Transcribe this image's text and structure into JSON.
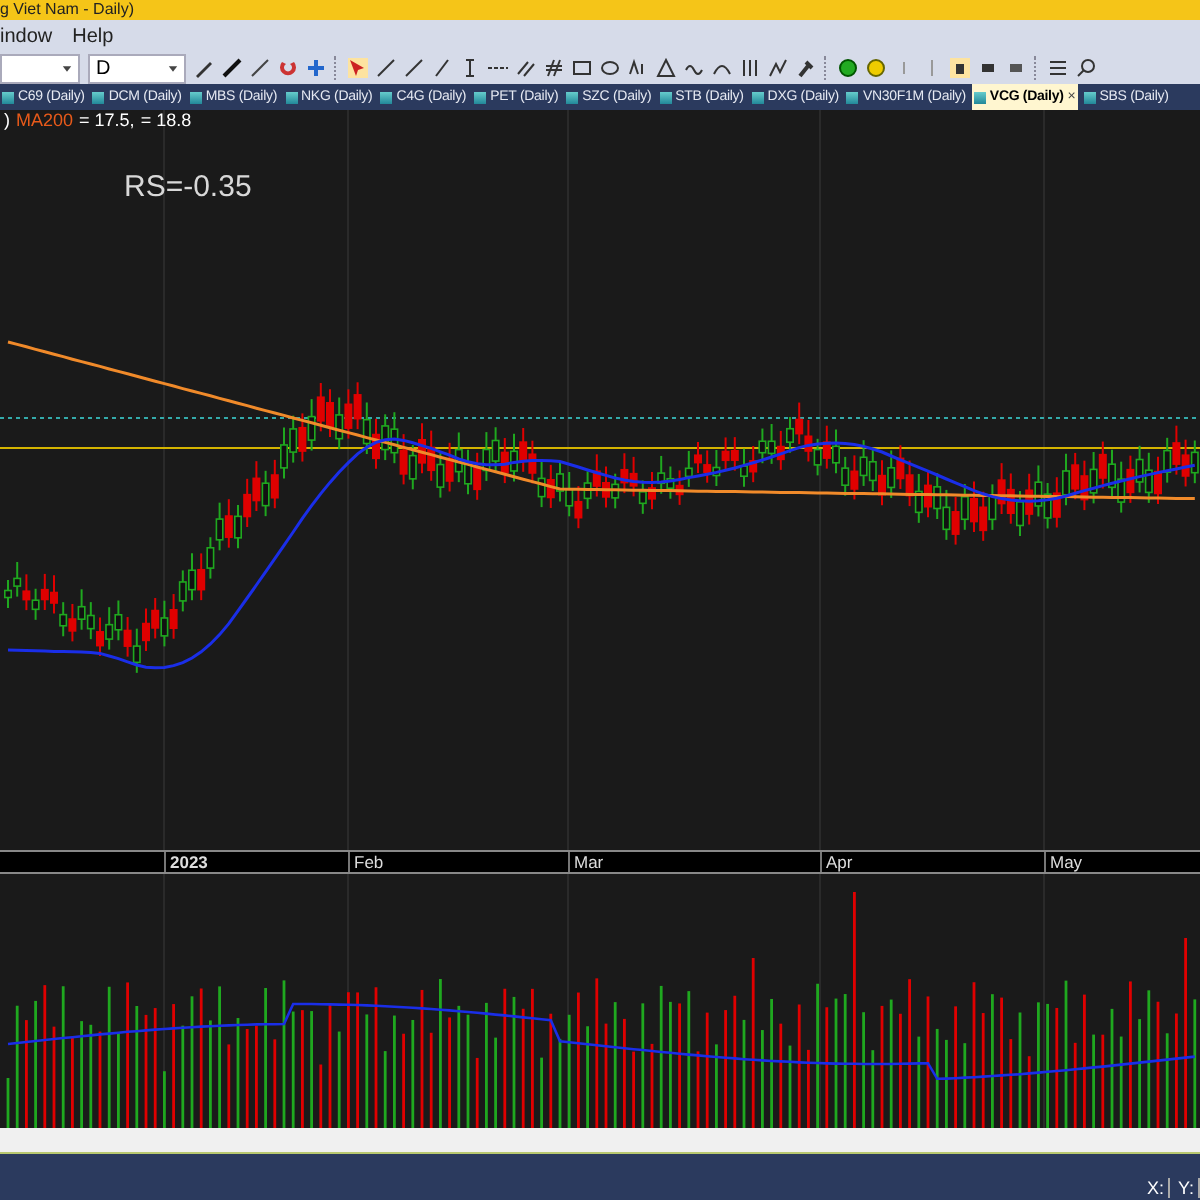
{
  "window": {
    "title": "g Viet Nam - Daily)"
  },
  "menu": [
    "indow",
    "Help"
  ],
  "toolbar": {
    "interval": "D"
  },
  "tabs": [
    {
      "label": "C69 (Daily)",
      "selected": false
    },
    {
      "label": "DCM (Daily)",
      "selected": false
    },
    {
      "label": "MBS (Daily)",
      "selected": false
    },
    {
      "label": "NKG (Daily)",
      "selected": false
    },
    {
      "label": "C4G (Daily)",
      "selected": false
    },
    {
      "label": "PET (Daily)",
      "selected": false
    },
    {
      "label": "SZC (Daily)",
      "selected": false
    },
    {
      "label": "STB (Daily)",
      "selected": false
    },
    {
      "label": "DXG (Daily)",
      "selected": false
    },
    {
      "label": "VN30F1M (Daily)",
      "selected": false
    },
    {
      "label": "VCG (Daily)",
      "selected": true,
      "close": "×"
    },
    {
      "label": "SBS (Daily)",
      "selected": false
    }
  ],
  "chart": {
    "legend": [
      {
        "text": ")",
        "color": "#ffffff"
      },
      {
        "text": "MA200",
        "color": "#e85a1a"
      },
      {
        "text": "= 17.5,",
        "color": "#ffffff"
      },
      {
        "text": "= 18.8",
        "color": "#ffffff"
      }
    ],
    "annotation": "RS=-0.35",
    "date_axis": [
      "2023",
      "Feb",
      "Mar",
      "Apr",
      "May"
    ]
  },
  "status_bar": [
    "X:",
    "Y:"
  ]
}
